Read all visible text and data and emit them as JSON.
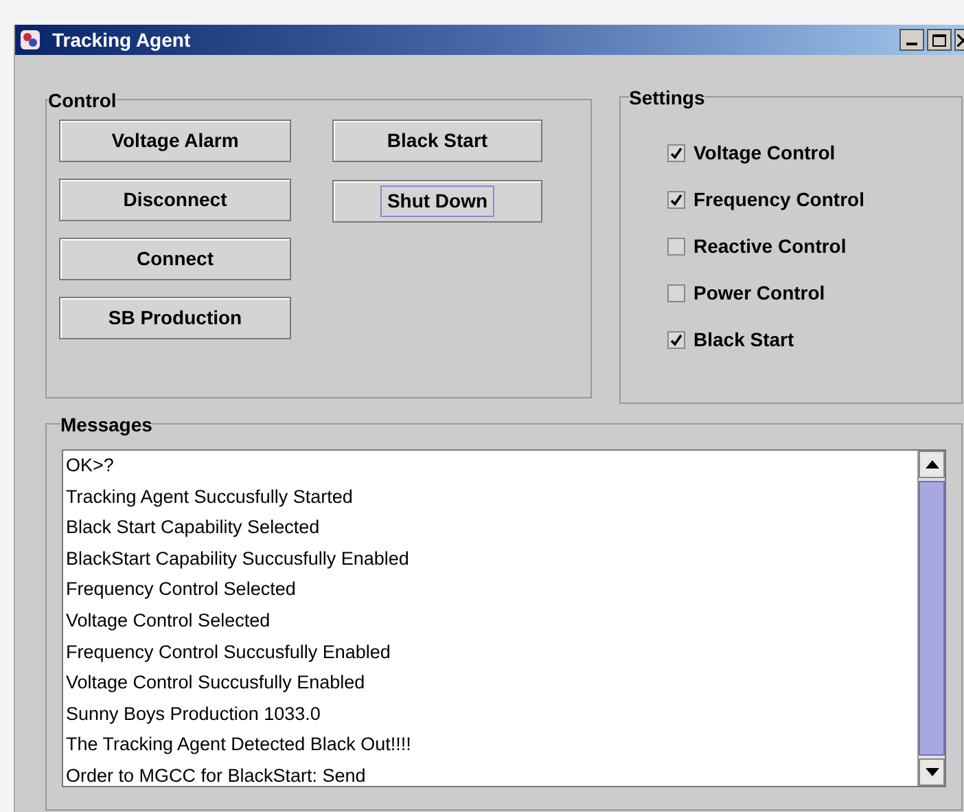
{
  "window": {
    "title": "Tracking Agent"
  },
  "control": {
    "title": "Control",
    "columns": [
      [
        {
          "label": "Voltage Alarm",
          "focused": false
        },
        {
          "label": "Disconnect",
          "focused": false
        },
        {
          "label": "Connect",
          "focused": false
        },
        {
          "label": "SB Production",
          "focused": false
        }
      ],
      [
        {
          "label": "Black Start",
          "focused": false
        },
        {
          "label": "Shut Down",
          "focused": true
        }
      ]
    ]
  },
  "settings": {
    "title": "Settings",
    "options": [
      {
        "label": "Voltage Control",
        "checked": true
      },
      {
        "label": "Frequency Control",
        "checked": true
      },
      {
        "label": "Reactive Control",
        "checked": false
      },
      {
        "label": "Power Control",
        "checked": false
      },
      {
        "label": "Black Start",
        "checked": true
      }
    ]
  },
  "messages": {
    "title": "Messages",
    "lines": [
      "OK>?",
      "Tracking Agent Succusfully Started",
      "Black Start Capability Selected",
      "BlackStart Capability Succusfully Enabled",
      "Frequency Control Selected",
      "Voltage Control Selected",
      "Frequency Control Succusfully Enabled",
      "Voltage Control Succusfully Enabled",
      "Sunny Boys Production 1033.0",
      "The Tracking Agent Detected Black Out!!!!",
      "Order to MGCC for BlackStart: Send"
    ]
  }
}
